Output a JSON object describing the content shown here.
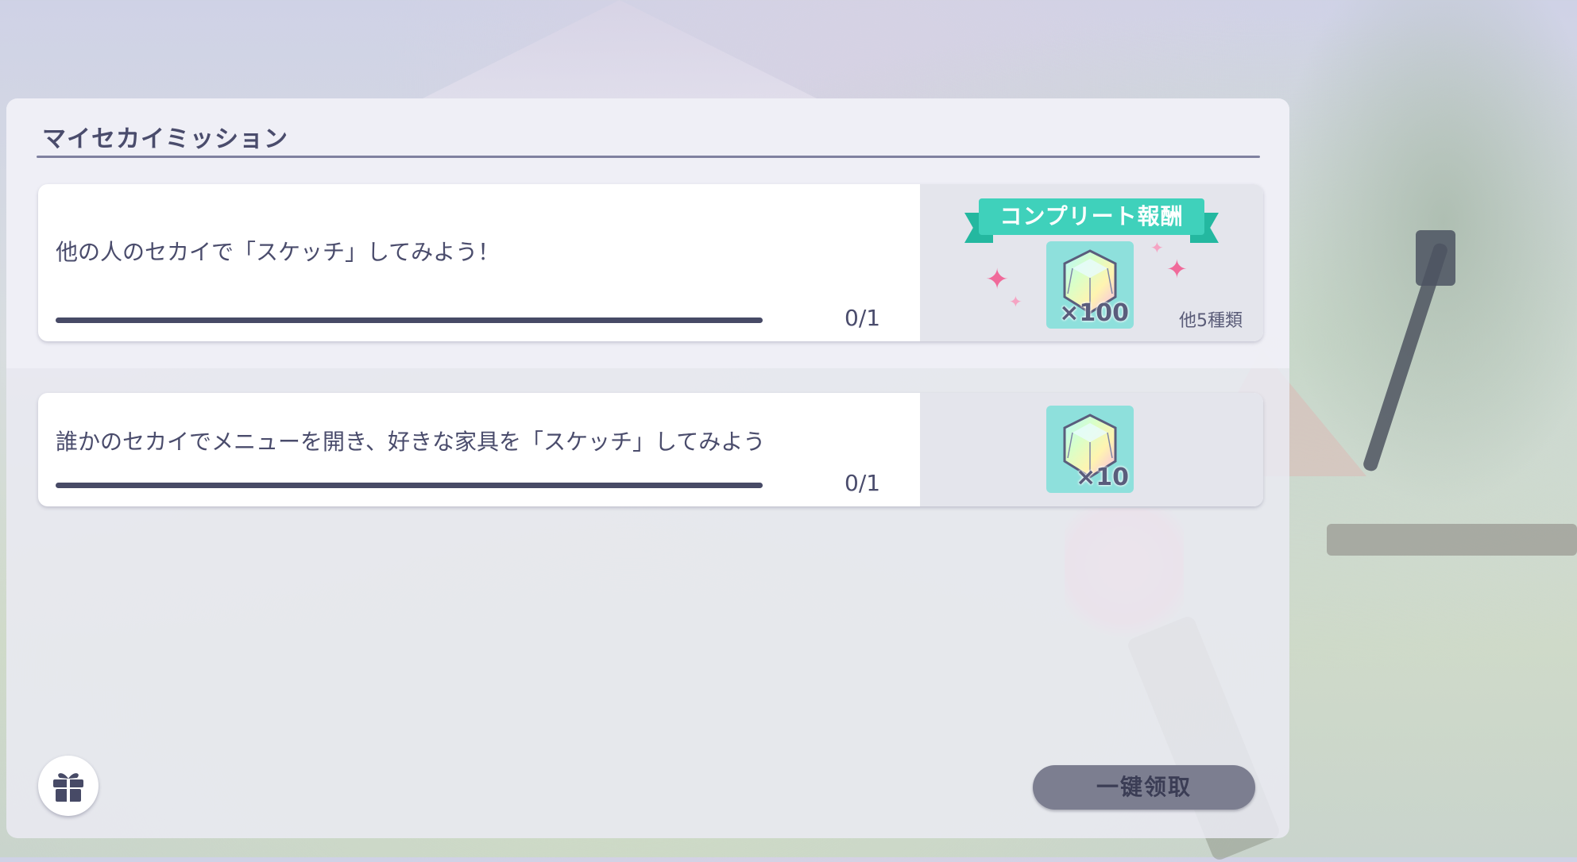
{
  "panel": {
    "title": "マイセカイミッション"
  },
  "missions": [
    {
      "description": "他の人のセカイで「スケッチ」してみよう！",
      "progress_text": "0/1",
      "progress_fraction": 0,
      "complete_reward_label": "コンプリート報酬",
      "reward_icon": "crystal-gem-icon",
      "reward_quantity": "×100",
      "other_rewards": "他5種類"
    },
    {
      "description": "誰かのセカイでメニューを開き、好きな家具を「スケッチ」してみよう",
      "progress_text": "0/1",
      "progress_fraction": 0,
      "reward_icon": "crystal-gem-icon",
      "reward_quantity": "×10"
    }
  ],
  "footer": {
    "gift_icon": "gift-icon",
    "claim_all_label": "一键领取"
  },
  "colors": {
    "accent_ribbon": "#3fd1bb",
    "text": "#4a4c6c",
    "progress_track": "#474a66",
    "claim_button": "#7c7e90"
  }
}
